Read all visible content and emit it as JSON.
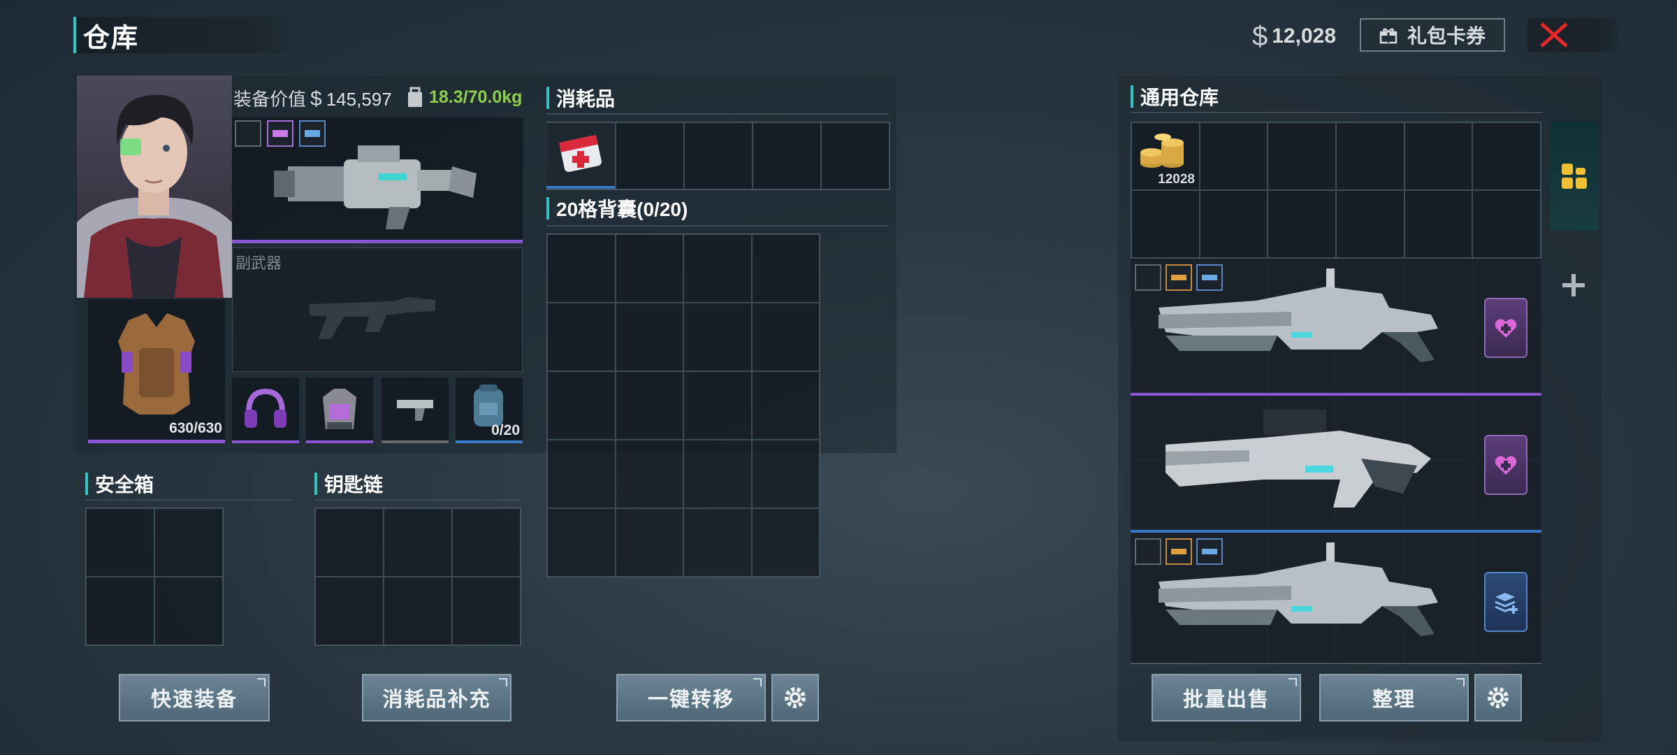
{
  "header": {
    "title": "仓库",
    "currency_symbol": "$",
    "money": "12,028",
    "gift_button": "礼包卡券"
  },
  "character": {
    "equip_value_label": "装备价值",
    "equip_value_symbol": "$",
    "equip_value": "145,597",
    "weight": "18.3/70.0kg",
    "secondary_weapon_label": "副武器",
    "armor_durability": "630/630",
    "backpack_capacity": "0/20"
  },
  "sections": {
    "consumables": "消耗品",
    "backpack": "20格背囊(0/20)",
    "safe_box": "安全箱",
    "keychain": "钥匙链",
    "general_storage": "通用仓库"
  },
  "storage": {
    "coin_count": "12028"
  },
  "buttons": {
    "quick_equip": "快速装备",
    "replenish": "消耗品补充",
    "transfer": "一键转移",
    "bulk_sell": "批量出售",
    "organize": "整理"
  },
  "colors": {
    "accent": "#2fc6c2",
    "rarity_purple": "#8c55d6",
    "rarity_blue": "#3a79c8",
    "weight_green": "#8ed04a",
    "close_red": "#e8282a",
    "view_toggle_yellow": "#f0c030"
  }
}
